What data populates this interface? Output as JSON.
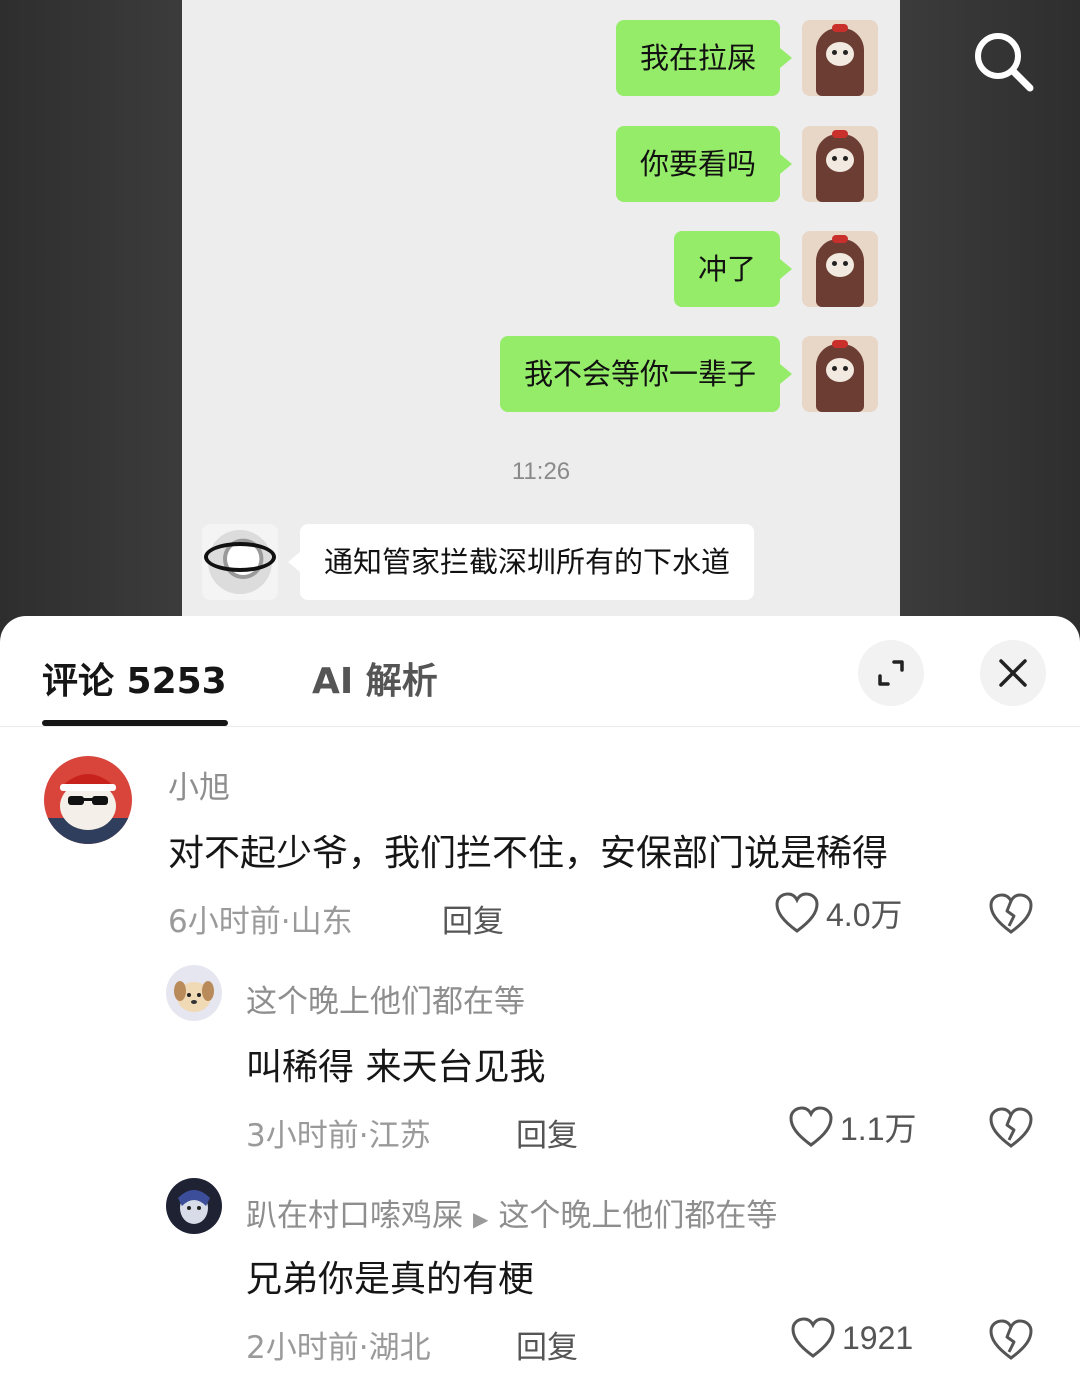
{
  "chat": {
    "sent_messages": [
      {
        "text": "我在拉屎"
      },
      {
        "text": "你要看吗"
      },
      {
        "text": "冲了"
      },
      {
        "text": "我不会等你一辈子"
      }
    ],
    "time": "11:26",
    "received_message": "通知管家拦截深圳所有的下水道"
  },
  "sheet": {
    "tab_comments": "评论 5253",
    "tab_ai": "AI 解析"
  },
  "comments": [
    {
      "user": "小旭",
      "text": "对不起少爷，我们拦不住，安保部门说是稀得",
      "meta": "6小时前·山东",
      "reply_label": "回复",
      "likes": "4.0万"
    },
    {
      "user": "这个晚上他们都在等",
      "text": "叫稀得 来天台见我",
      "meta": "3小时前·江苏",
      "reply_label": "回复",
      "likes": "1.1万"
    },
    {
      "user": "趴在村口嗦鸡屎",
      "reply_to": "这个晚上他们都在等",
      "text": "兄弟你是真的有梗",
      "meta": "2小时前·湖北",
      "reply_label": "回复",
      "likes": "1921"
    }
  ],
  "colors": {
    "sent_bubble": "#95ec69",
    "chat_bg": "#ededed",
    "text_primary": "#161616",
    "text_secondary": "#8e8e8e"
  },
  "icons": [
    "search-icon",
    "expand-icon",
    "close-icon",
    "heart-icon",
    "broken-heart-icon"
  ]
}
